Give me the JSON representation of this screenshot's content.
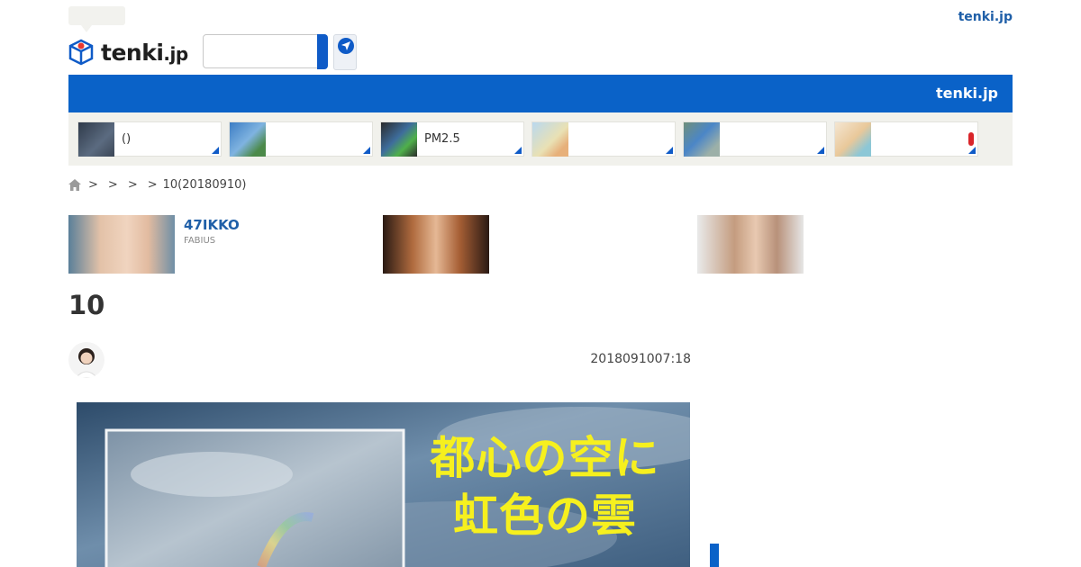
{
  "header": {
    "logo_text": "tenki",
    "logo_suffix": ".jp",
    "search_placeholder": "",
    "top_link": "tenki.jp"
  },
  "navbar": {
    "brand": "tenki.jp"
  },
  "tiles": [
    {
      "label": "()",
      "icon": "satellite-map"
    },
    {
      "label": "",
      "icon": "radar-map"
    },
    {
      "label": "PM2.5",
      "icon": "pm25-map"
    },
    {
      "label": "",
      "icon": "japan-map"
    },
    {
      "label": "",
      "icon": "rain-map"
    },
    {
      "label": "",
      "icon": "lifestyle-index"
    }
  ],
  "breadcrumb": {
    "separators": [
      ">",
      ">",
      ">",
      ">"
    ],
    "current": "10(20180910)"
  },
  "related": [
    {
      "title": "47IKKO",
      "source": "FABIUS"
    },
    {
      "title": "",
      "source": ""
    },
    {
      "title": "",
      "source": ""
    }
  ],
  "article": {
    "title": "10",
    "date": "2018091007:18",
    "image_caption": [
      "都心の空に",
      "虹色の雲"
    ]
  },
  "colors": {
    "brand_blue": "#0a62c8",
    "link_blue": "#1f5fa8",
    "caption_yellow": "#f6f01e"
  }
}
